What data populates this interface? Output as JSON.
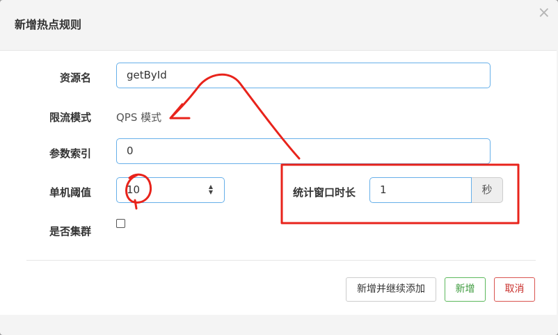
{
  "dialog": {
    "title": "新增热点规则",
    "close_glyph": "×"
  },
  "form": {
    "resource": {
      "label": "资源名",
      "value": "getById"
    },
    "mode": {
      "label": "限流模式",
      "value": "QPS 模式"
    },
    "param_index": {
      "label": "参数索引",
      "value": "0"
    },
    "threshold": {
      "label": "单机阈值",
      "value": "10"
    },
    "window": {
      "label": "统计窗口时长",
      "value": "1",
      "unit": "秒"
    },
    "cluster": {
      "label": "是否集群",
      "checked": false
    }
  },
  "footer": {
    "add_continue": "新增并继续添加",
    "add": "新增",
    "cancel": "取消"
  },
  "annotation": {
    "stroke_color": "#e8231b",
    "icons": [
      "arrow-annotation",
      "circle-annotation",
      "rectangle-annotation"
    ]
  }
}
